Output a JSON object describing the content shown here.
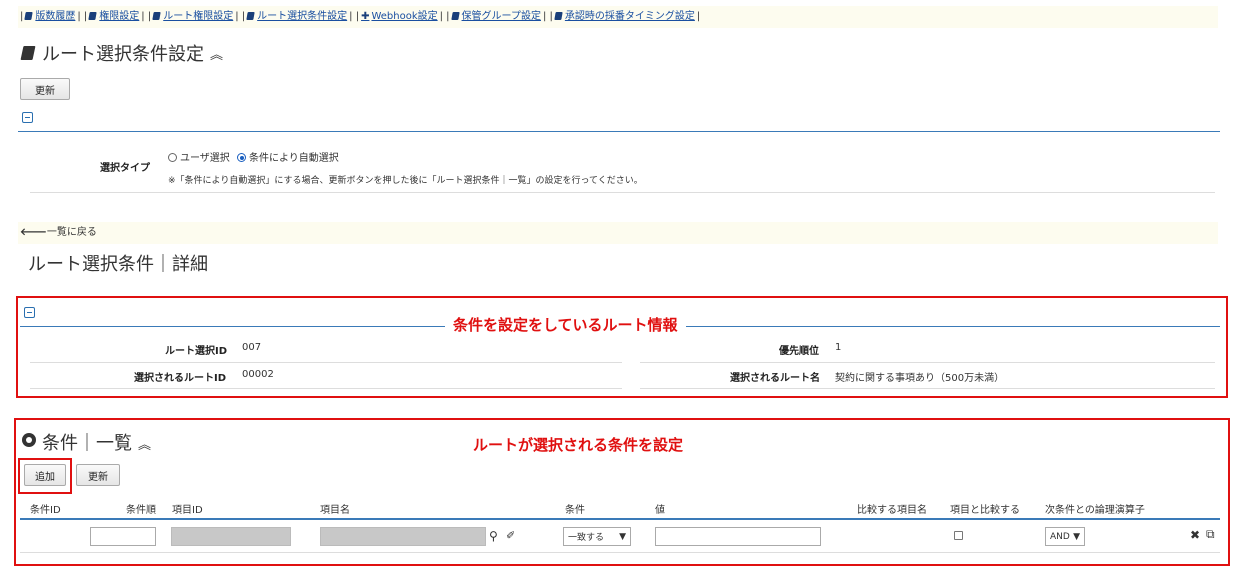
{
  "topnav": {
    "links": [
      "版数履歴",
      "権限設定",
      "ルート権限設定",
      "ルート選択条件設定",
      "Webhook設定",
      "保管グループ設定",
      "承認時の採番タイミング設定"
    ]
  },
  "route_select_settings": {
    "title": "ルート選択条件設定",
    "update_label": "更新",
    "select_type_label": "選択タイプ",
    "option_user": "ユーザ選択",
    "option_auto": "条件により自動選択",
    "selected": "条件により自動選択",
    "note": "※「条件により自動選択」にする場合、更新ボタンを押した後に「ルート選択条件｜一覧」の設定を行ってください。"
  },
  "back_link": "一覧に戻る",
  "detail": {
    "title": "ルート選択条件｜詳細",
    "annotation": "条件を設定をしているルート情報",
    "fields": {
      "route_select_id_label": "ルート選択ID",
      "route_select_id": "007",
      "priority_label": "優先順位",
      "priority": "1",
      "route_id_label": "選択されるルートID",
      "route_id": "00002",
      "route_name_label": "選択されるルート名",
      "route_name": "契約に関する事項あり（500万未満）"
    }
  },
  "conditions": {
    "title": "条件｜一覧",
    "annotation": "ルートが選択される条件を設定",
    "add_label": "追加",
    "update_label": "更新",
    "columns": [
      "条件ID",
      "条件順",
      "項目ID",
      "項目名",
      "条件",
      "値",
      "比較する項目名",
      "項目と比較する",
      "次条件との論理演算子"
    ],
    "row": {
      "operator": "一致する",
      "logic": "AND",
      "compare_checked": false
    }
  },
  "colors": {
    "annotation_red": "#e01010",
    "link_blue": "#1a4fa0",
    "rule_blue": "#3a7ab8",
    "nav_bg": "#fdfcef"
  }
}
